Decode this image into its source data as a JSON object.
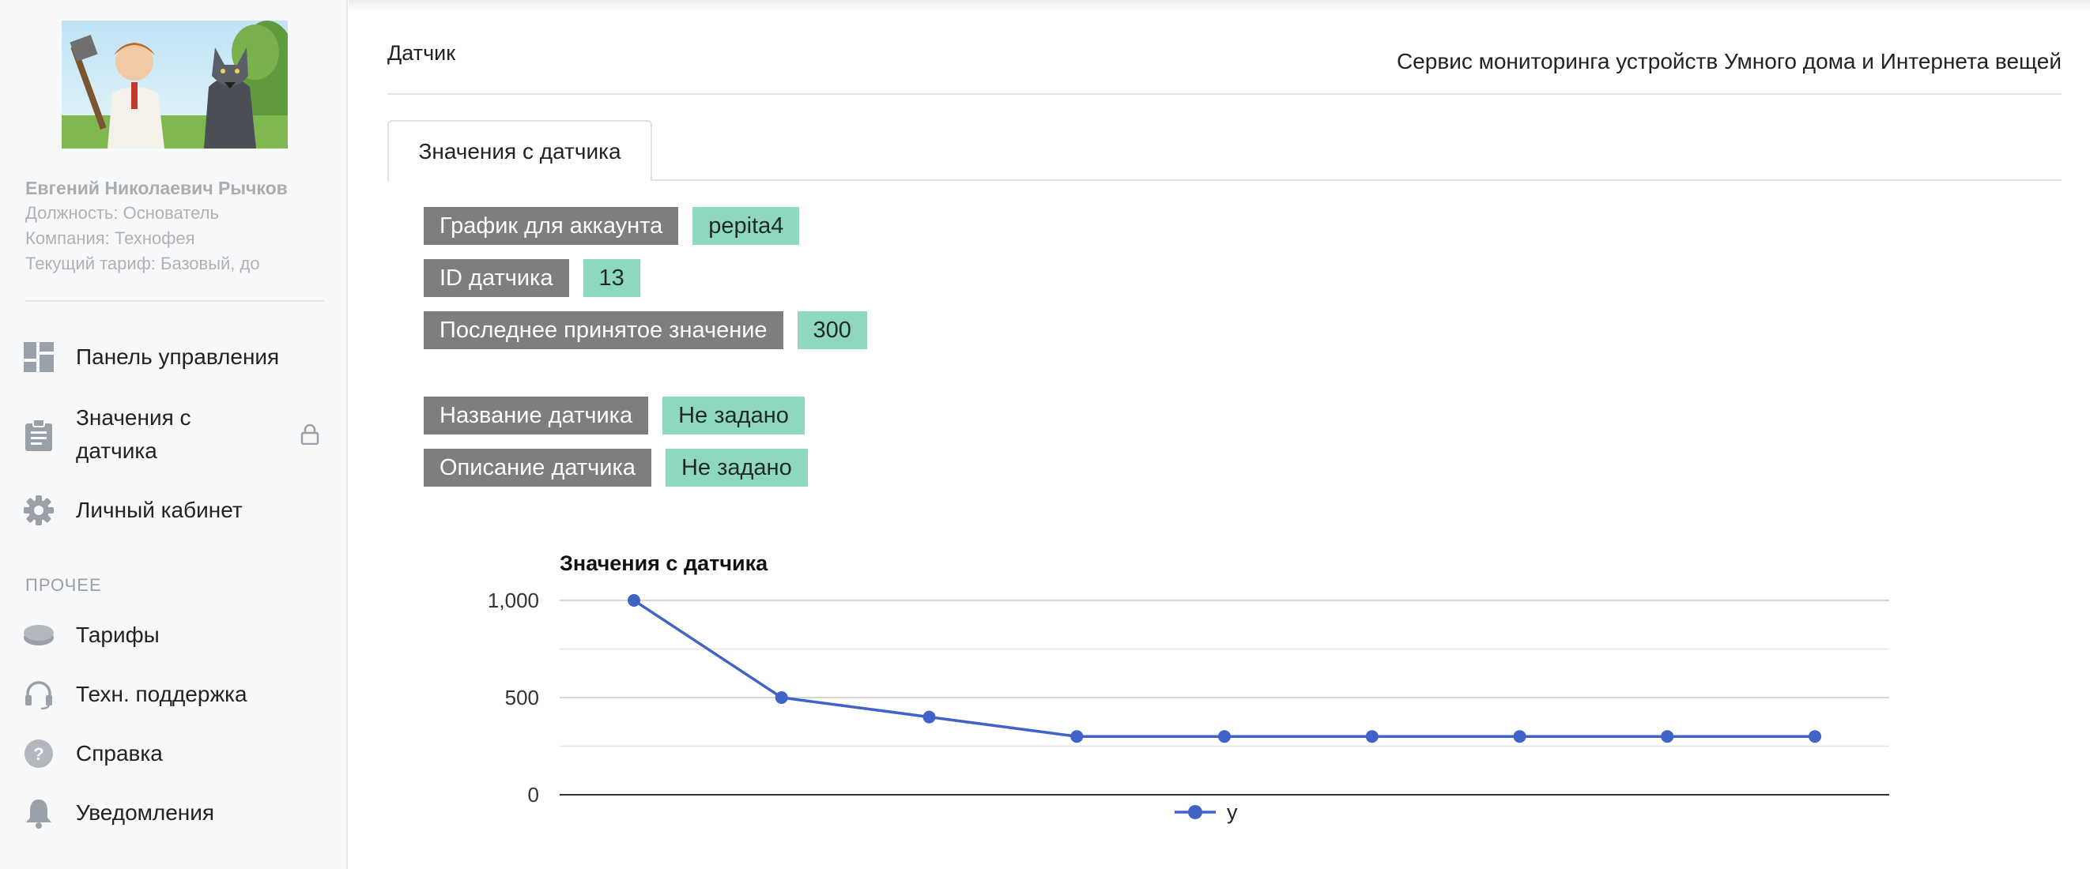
{
  "sidebar": {
    "user": {
      "name": "Евгений Николаевич Рычков",
      "position": "Должность: Основатель",
      "company": "Компания: Технофея",
      "tariff": "Текущий тариф: Базовый, до"
    },
    "nav": [
      {
        "label": "Панель управления",
        "icon": "dashboard-icon"
      },
      {
        "label_line1": "Значения с",
        "label_line2": "датчика",
        "icon": "clipboard-icon",
        "locked": true
      },
      {
        "label": "Личный кабинет",
        "icon": "gear-icon"
      }
    ],
    "section_title": "ПРОЧЕЕ",
    "other": [
      {
        "label": "Тарифы",
        "icon": "coins-icon"
      },
      {
        "label": "Техн. поддержка",
        "icon": "headset-icon"
      },
      {
        "label": "Справка",
        "icon": "help-icon"
      },
      {
        "label": "Уведомления",
        "icon": "bell-icon"
      }
    ]
  },
  "header": {
    "page_title": "Датчик",
    "service_title": "Сервис мониторинга устройств Умного дома и Интернета вещей"
  },
  "tabs": [
    {
      "label": "Значения с датчика",
      "active": true
    }
  ],
  "info": [
    {
      "label": "График для аккаунта",
      "value": "pepita4"
    },
    {
      "label": "ID датчика",
      "value": "13"
    },
    {
      "label": "Последнее принятое значение",
      "value": "300"
    },
    {
      "label": "Название датчика",
      "value": "Не задано"
    },
    {
      "label": "Описание датчика",
      "value": "Не задано"
    }
  ],
  "colors": {
    "label_bg": "#7d7e80",
    "value_bg": "#8fd8c0",
    "series": "#3f63c7"
  },
  "chart_data": {
    "type": "line",
    "title": "Значения с датчика",
    "x": [
      1,
      2,
      3,
      4,
      5,
      6,
      7,
      8,
      9
    ],
    "series": [
      {
        "name": "y",
        "values": [
          1000,
          500,
          400,
          300,
          300,
          300,
          300,
          300,
          300
        ]
      }
    ],
    "yticks": [
      "1,000",
      "500",
      "0"
    ],
    "ylim": [
      0,
      1000
    ],
    "grid": true,
    "legend_position": "bottom"
  }
}
